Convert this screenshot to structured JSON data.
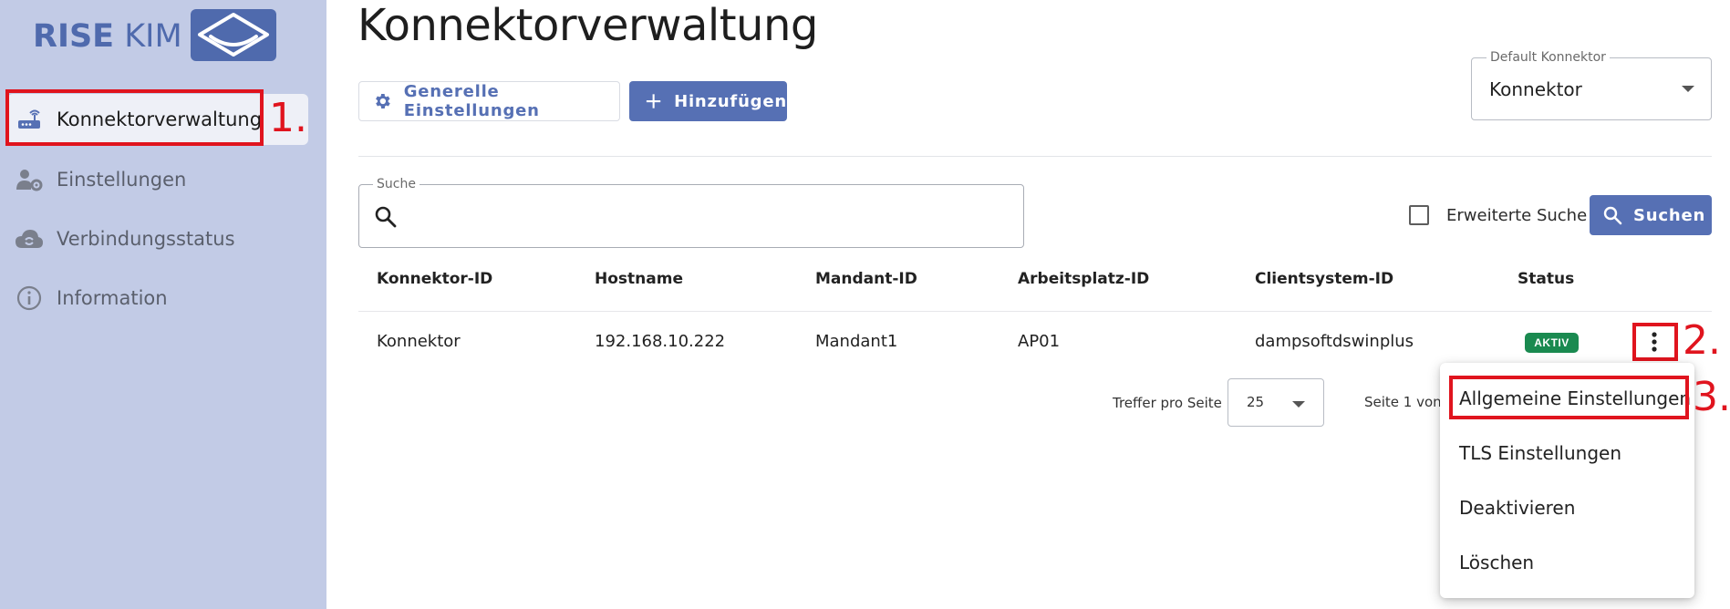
{
  "sidebar": {
    "logo_text_bold": "RISE",
    "logo_text_light": "KIM",
    "items": [
      {
        "label": "Konnektorverwaltung",
        "icon": "router-icon",
        "active": true
      },
      {
        "label": "Einstellungen",
        "icon": "user-gear-icon",
        "active": false
      },
      {
        "label": "Verbindungsstatus",
        "icon": "cloud-sync-icon",
        "active": false
      },
      {
        "label": "Information",
        "icon": "info-circle-icon",
        "active": false
      }
    ]
  },
  "main": {
    "title": "Konnektorverwaltung",
    "toolbar": {
      "general_settings_label": "Generelle Einstellungen",
      "add_label": "Hinzufügen"
    },
    "default_connector": {
      "label": "Default Konnektor",
      "value": "Konnektor"
    },
    "search": {
      "label": "Suche",
      "value": "",
      "extended_search_label": "Erweiterte Suche",
      "extended_search_checked": false,
      "search_button_label": "Suchen"
    },
    "table": {
      "columns": [
        "Konnektor-ID",
        "Hostname",
        "Mandant-ID",
        "Arbeitsplatz-ID",
        "Clientsystem-ID",
        "Status"
      ],
      "rows": [
        {
          "konnektor_id": "Konnektor",
          "hostname": "192.168.10.222",
          "mandant_id": "Mandant1",
          "arbeitsplatz_id": "AP01",
          "clientsystem_id": "dampsoftdswinplus",
          "status": "AKTIV"
        }
      ]
    },
    "pagination": {
      "per_page_label": "Treffer pro Seite",
      "per_page_value": "25",
      "page_info": "Seite 1 von"
    },
    "context_menu": {
      "items": [
        "Allgemeine Einstellungen",
        "TLS Einstellungen",
        "Deaktivieren",
        "Löschen"
      ]
    }
  },
  "annotations": [
    "1.",
    "2.",
    "3."
  ],
  "colors": {
    "sidebar_bg": "#c2cbe6",
    "primary": "#5670b4",
    "status_active": "#1a8a50",
    "annotation_red": "#e0141e"
  }
}
